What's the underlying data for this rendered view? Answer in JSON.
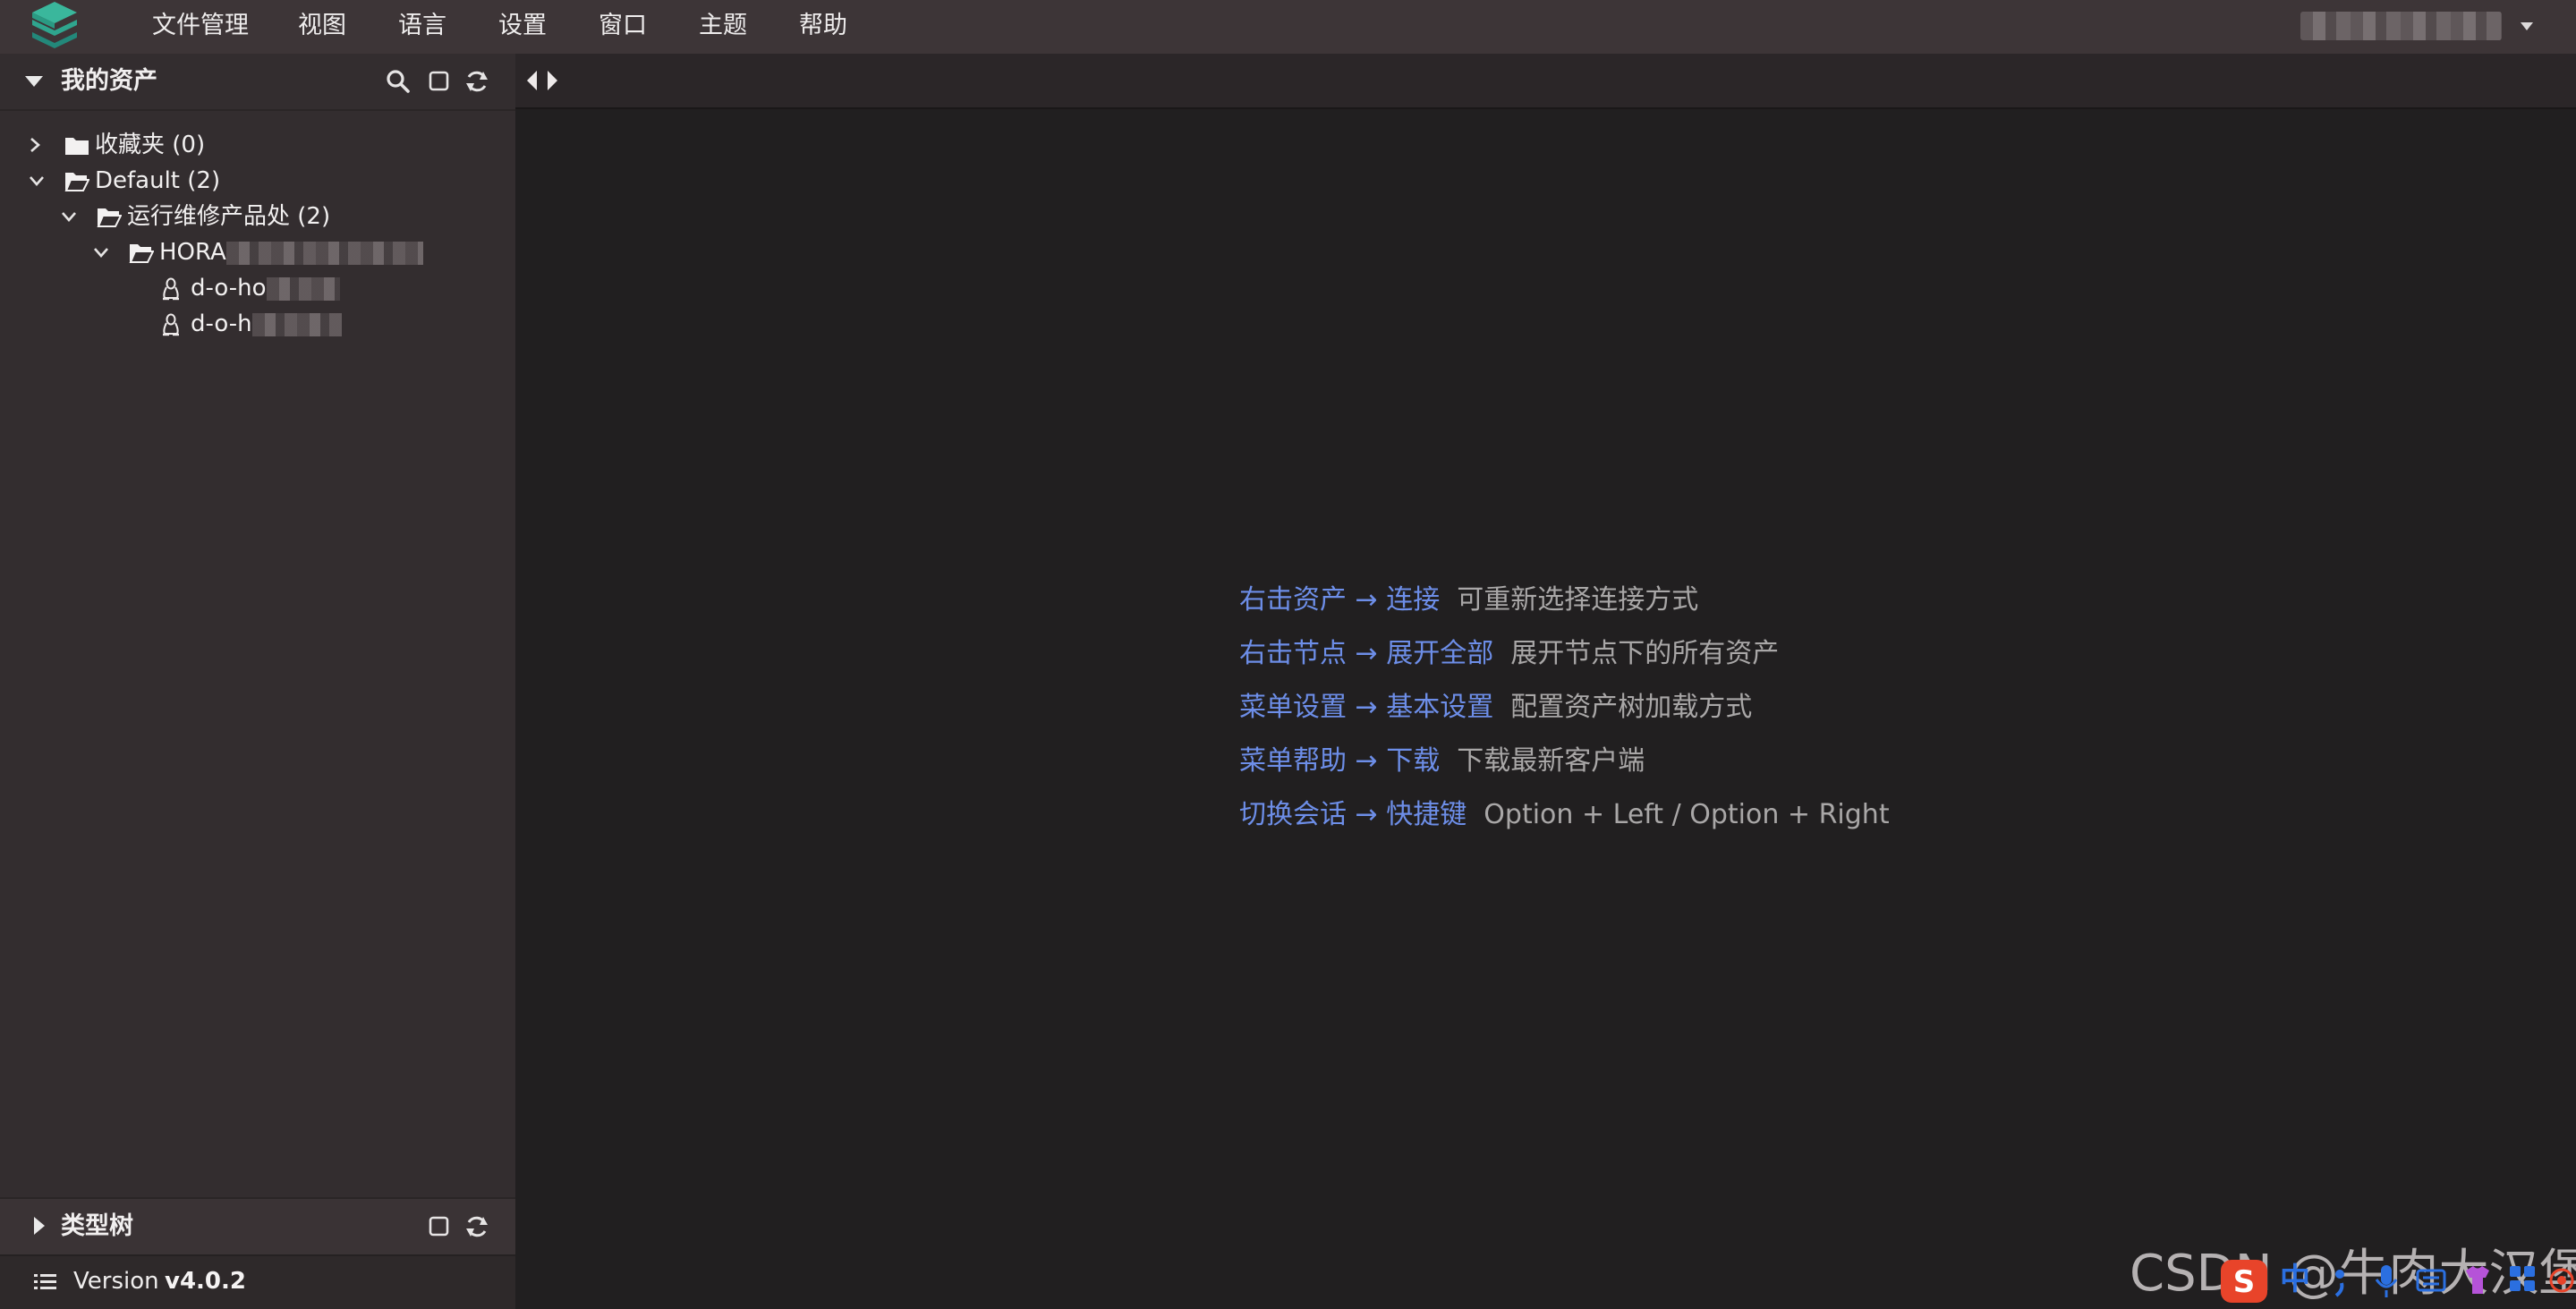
{
  "menubar": {
    "items": [
      "文件管理",
      "视图",
      "语言",
      "设置",
      "窗口",
      "主题",
      "帮助"
    ]
  },
  "sidebar": {
    "title": "我的资产",
    "tree": {
      "favorites": "收藏夹 (0)",
      "default": "Default (2)",
      "department": "运行维修产品处 (2)",
      "node_prefix": "HORA",
      "host1_prefix": "d-o-ho",
      "host2_prefix": "d-o-h"
    },
    "types_title": "类型树",
    "version_label": "Version",
    "version_value": "v4.0.2"
  },
  "main": {
    "tips": [
      {
        "action": "右击资产 → 连接",
        "desc": "可重新选择连接方式"
      },
      {
        "action": "右击节点 → 展开全部",
        "desc": "展开节点下的所有资产"
      },
      {
        "action": "菜单设置 → 基本设置",
        "desc": "配置资产树加载方式"
      },
      {
        "action": "菜单帮助 → 下载",
        "desc": "下载最新客户端"
      },
      {
        "action": "切换会话 → 快捷键",
        "desc": "Option + Left / Option + Right"
      }
    ]
  },
  "watermark": "CSDN @牛肉大汉堡",
  "ime": {
    "lang": "中"
  },
  "colors": {
    "menubar_bg": "#3d3537",
    "sidebar_bg": "#332d2f",
    "main_bg": "#211f20",
    "tip_action": "#6d8ee8",
    "tip_desc": "#a9a7a7",
    "logo": "#2fa58e"
  },
  "icons": {
    "logo": "layers-logo",
    "search": "search-icon",
    "collapse": "square-icon",
    "refresh": "refresh-icon",
    "folder": "folder-icon",
    "linux": "linux-icon",
    "version": "list-icon"
  }
}
